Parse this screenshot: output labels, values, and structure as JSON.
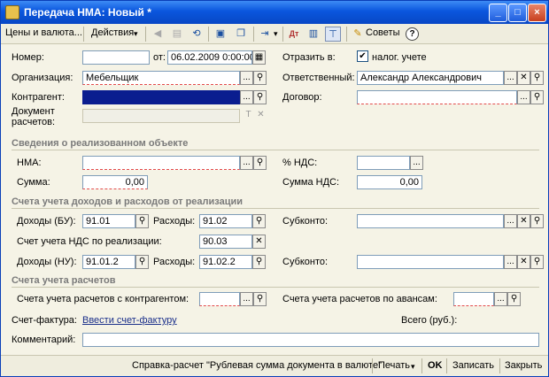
{
  "window": {
    "title": "Передача НМА: Новый *",
    "min": "_",
    "max": "□",
    "close": "×"
  },
  "toolbar": {
    "prices": "Цены и валюта...",
    "actions": "Действия",
    "dropdown_arrow": "▾",
    "advice": "Советы",
    "help": "?"
  },
  "form": {
    "number_label": "Номер:",
    "number_value": "",
    "date_label": "от:",
    "date_value": "06.02.2009  0:00:00",
    "reflect_label": "Отразить в:",
    "tax_check_label": "налог. учете",
    "org_label": "Организация:",
    "org_value": "Мебельщик",
    "responsible_label": "Ответственный:",
    "responsible_value": "Александр Александрович",
    "contractor_label": "Контрагент:",
    "contractor_value": "",
    "contract_label": "Договор:",
    "contract_value": "",
    "settlement_doc_label1": "Документ",
    "settlement_doc_label2": "расчетов:",
    "settlement_doc_value": ""
  },
  "sections": {
    "sold_object": "Сведения о реализованном объекте",
    "income_expense": "Счета учета доходов и расходов от реализации",
    "settlements": "Счета учета расчетов"
  },
  "sold": {
    "nma_label": "НМА:",
    "nma_value": "",
    "vat_pct_label": "% НДС:",
    "vat_pct_value": "",
    "sum_label": "Сумма:",
    "sum_value": "0,00",
    "vat_sum_label": "Сумма НДС:",
    "vat_sum_value": "0,00"
  },
  "accounts": {
    "income_bu_label": "Доходы (БУ):",
    "income_bu_value": "91.01",
    "expense_label": "Расходы:",
    "expense_bu_value": "91.02",
    "subconto_label": "Субконто:",
    "subconto1_value": "",
    "vat_acc_label": "Счет учета НДС по реализации:",
    "vat_acc_value": "90.03",
    "income_nu_label": "Доходы (НУ):",
    "income_nu_value": "91.01.2",
    "expense_nu_value": "91.02.2",
    "subconto2_value": ""
  },
  "settle": {
    "contractor_acc_label": "Счета учета расчетов с контрагентом:",
    "contractor_acc_value": "",
    "advance_acc_label": "Счета учета расчетов по авансам:",
    "advance_acc_value": "",
    "invoice_label": "Счет-фактура:",
    "invoice_link": "Ввести счет-фактуру",
    "total_label": "Всего (руб.):",
    "comment_label": "Комментарий:",
    "comment_value": ""
  },
  "bottom": {
    "report": "Справка-расчет \"Рублевая сумма документа в валюте\"",
    "print": "Печать",
    "print_arrow": "▾",
    "ok": "OK",
    "save": "Записать",
    "close": "Закрыть"
  },
  "glyphs": {
    "dots": "...",
    "search": "⚲",
    "clear": "✕",
    "check": "✔",
    "calendar": "▦",
    "text": "T"
  }
}
